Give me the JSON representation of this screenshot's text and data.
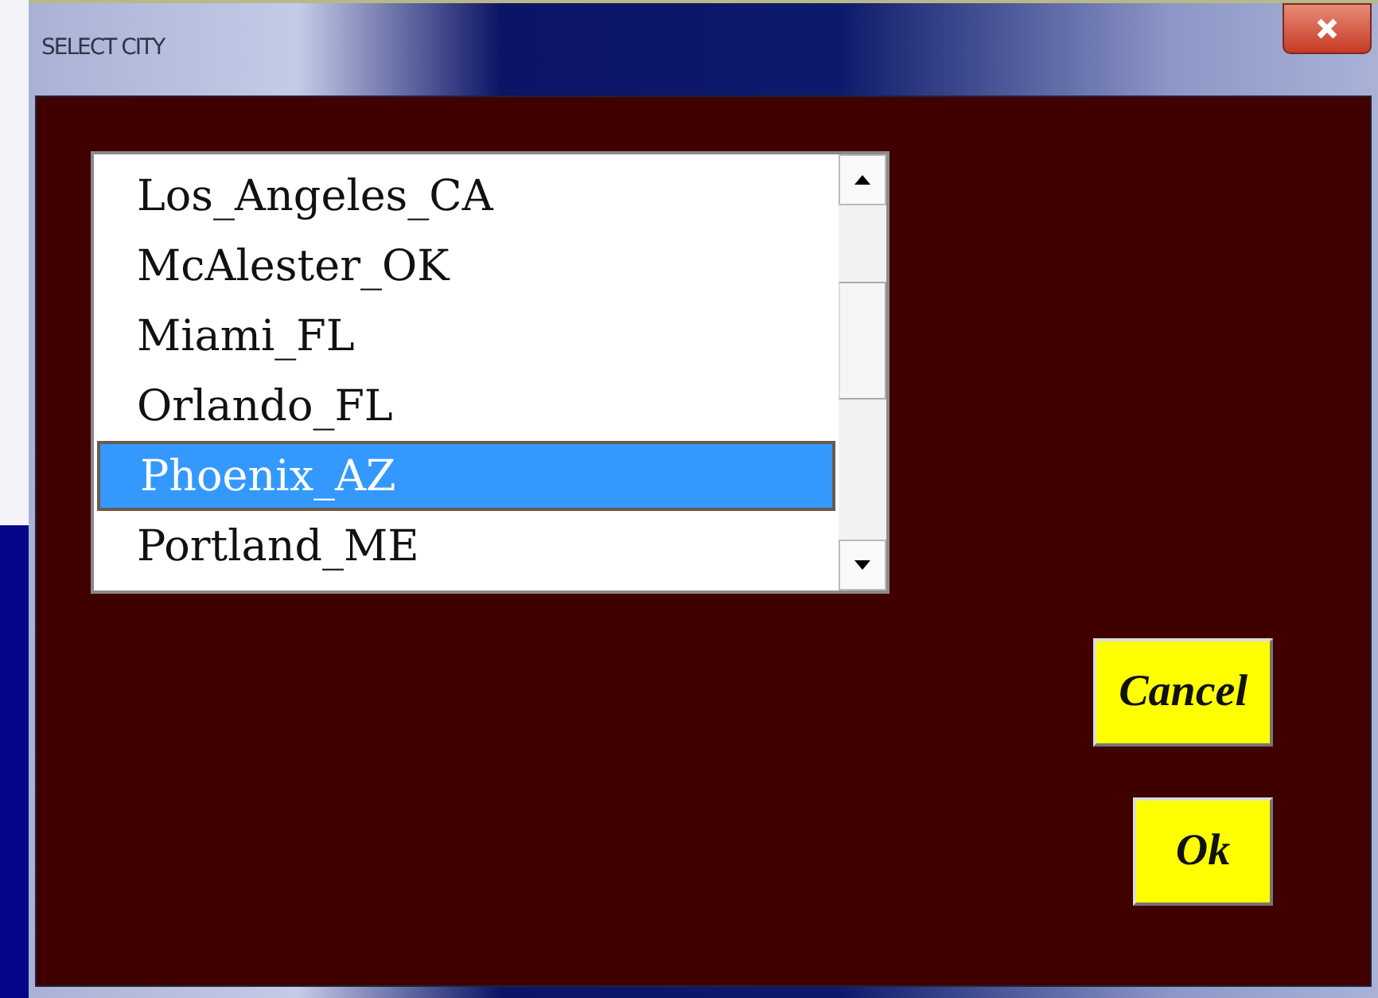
{
  "window": {
    "title": "SELECT CITY"
  },
  "cities": [
    {
      "label": "Los_Angeles_CA",
      "selected": false
    },
    {
      "label": "McAlester_OK",
      "selected": false
    },
    {
      "label": "Miami_FL",
      "selected": false
    },
    {
      "label": "Orlando_FL",
      "selected": false
    },
    {
      "label": "Phoenix_AZ",
      "selected": true
    },
    {
      "label": "Portland_ME",
      "selected": false
    }
  ],
  "buttons": [
    {
      "label": "Cancel"
    },
    {
      "label": "Ok"
    }
  ]
}
